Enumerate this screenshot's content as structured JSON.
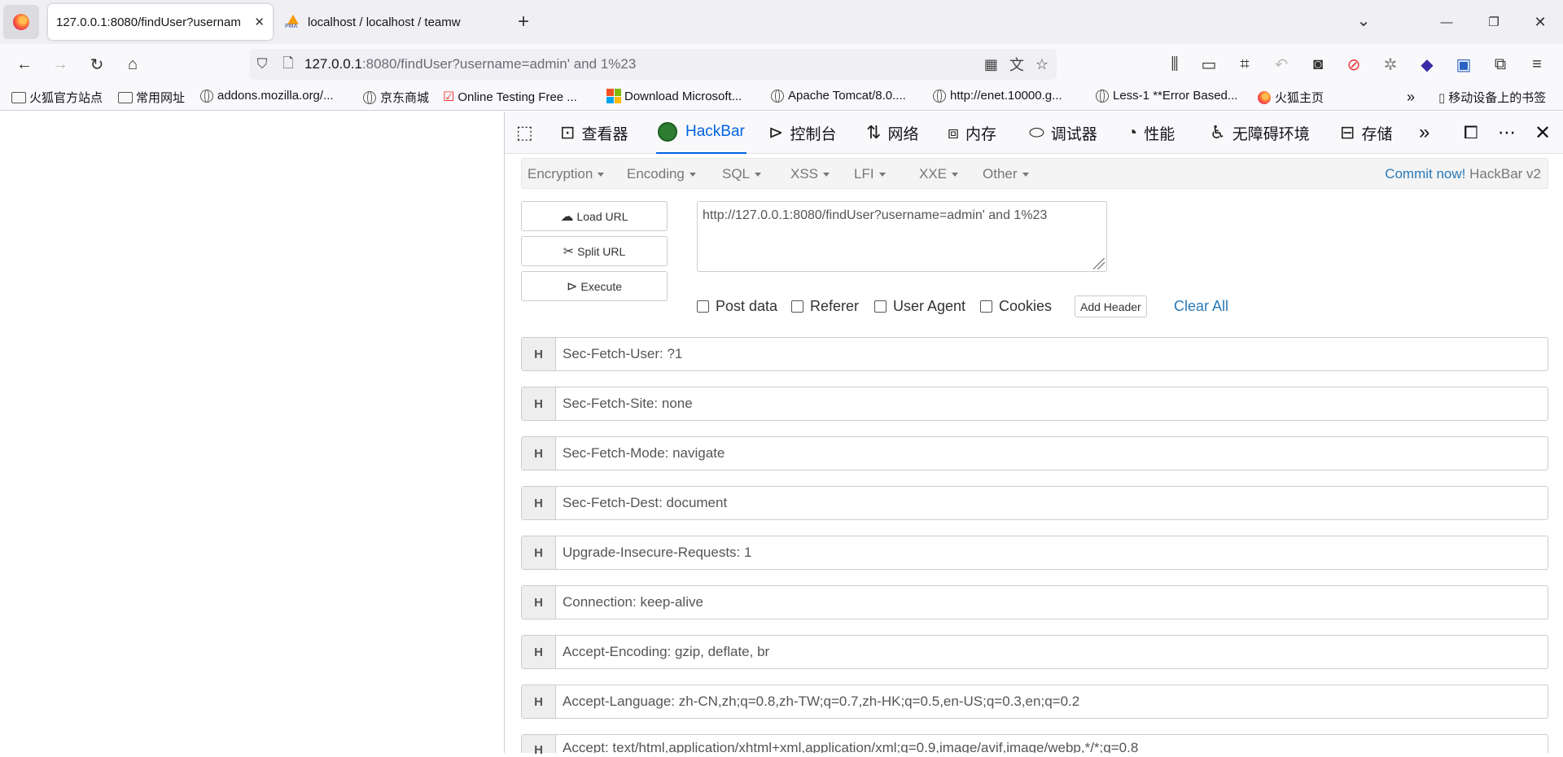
{
  "tabs": [
    {
      "title": "127.0.0.1:8080/findUser?usernam",
      "close": "✕"
    },
    {
      "title": "localhost / localhost / teamw",
      "pma": "PMA"
    }
  ],
  "tabstrip": {
    "new_tab": "+",
    "list_all": "⌄",
    "minimize": "—",
    "restore": "❐",
    "close": "✕"
  },
  "urlbar": {
    "host": "127.0.0.1",
    "rest": ":8080/findUser?username=admin' and 1%23"
  },
  "bookmarks": [
    {
      "label": "火狐官方站点",
      "icon": "folder-icon"
    },
    {
      "label": "常用网址",
      "icon": "folder-icon"
    },
    {
      "label": "addons.mozilla.org/...",
      "icon": "globe-icon"
    },
    {
      "label": "京东商城",
      "icon": "globe-icon"
    },
    {
      "label": "Online Testing Free ...",
      "icon": "check-icon"
    },
    {
      "label": "Download Microsoft...",
      "icon": "microsoft-icon"
    },
    {
      "label": "Apache Tomcat/8.0....",
      "icon": "globe-icon"
    },
    {
      "label": "http://enet.10000.g...",
      "icon": "globe-icon"
    },
    {
      "label": "Less-1 **Error Based...",
      "icon": "globe-icon"
    },
    {
      "label": "火狐主页",
      "icon": "firefox-icon"
    }
  ],
  "mobile_bookmarks": "移动设备上的书签",
  "devtools": {
    "tabs": [
      "查看器",
      "HackBar",
      "控制台",
      "网络",
      "内存",
      "调试器",
      "性能",
      "无障碍环境",
      "存储"
    ]
  },
  "hackbar": {
    "menu": [
      "Encryption",
      "Encoding",
      "SQL",
      "XSS",
      "LFI",
      "XXE",
      "Other"
    ],
    "commit_link": "Commit now!",
    "commit_suffix": "HackBar v2",
    "load_url": "Load URL",
    "split_url": "Split URL",
    "execute": "Execute",
    "url_value": "http://127.0.0.1:8080/findUser?username=admin' and 1%23",
    "options": [
      "Post data",
      "Referer",
      "User Agent",
      "Cookies"
    ],
    "add_header": "Add Header",
    "clear_all": "Clear All",
    "header_tag": "H",
    "headers": [
      "Sec-Fetch-User: ?1",
      "Sec-Fetch-Site: none",
      "Sec-Fetch-Mode: navigate",
      "Sec-Fetch-Dest: document",
      "Upgrade-Insecure-Requests: 1",
      "Connection: keep-alive",
      "Accept-Encoding: gzip, deflate, br",
      "Accept-Language: zh-CN,zh;q=0.8,zh-TW;q=0.7,zh-HK;q=0.5,en-US;q=0.3,en;q=0.2",
      "Accept: text/html,application/xhtml+xml,application/xml;q=0.9,image/avif,image/webp,*/*;q=0.8"
    ]
  }
}
